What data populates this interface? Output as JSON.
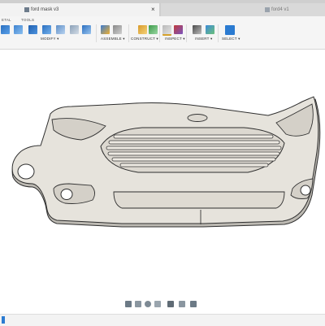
{
  "tabs": [
    {
      "label": "ford mask v3",
      "active": true
    },
    {
      "label": "ford4 v1",
      "active": false
    }
  ],
  "ribbon": {
    "subtabs": [
      "ETAL",
      "TOOLS"
    ],
    "groups": [
      {
        "label": "MODIFY ▾"
      },
      {
        "label": "ASSEMBLE ▾"
      },
      {
        "label": "CONSTRUCT ▾"
      },
      {
        "label": "INSPECT ▾"
      },
      {
        "label": "INSERT ▾"
      },
      {
        "label": "SELECT ▾"
      }
    ]
  },
  "colors": {
    "accent": "#2b7bd1",
    "model_fill": "#e6e3dc",
    "model_stroke": "#3a3a3a"
  },
  "navigation_bar": {
    "icons": [
      "orbit-icon",
      "pan-icon",
      "zoom-icon",
      "fit-icon",
      "display-mode-icon",
      "grid-icon",
      "viewports-icon"
    ]
  }
}
